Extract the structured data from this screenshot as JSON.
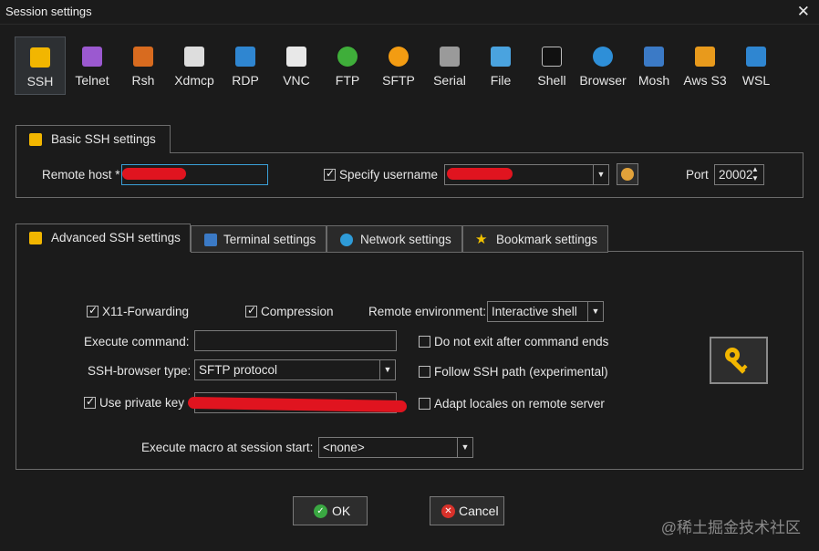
{
  "window": {
    "title": "Session settings"
  },
  "protocols": [
    {
      "label": "SSH",
      "icon": "key-icon",
      "color": "#f2b600",
      "active": true
    },
    {
      "label": "Telnet",
      "icon": "telnet-icon",
      "color": "#9b59d0"
    },
    {
      "label": "Rsh",
      "icon": "rsh-icon",
      "color": "#d86b1f"
    },
    {
      "label": "Xdmcp",
      "icon": "xdmcp-icon",
      "color": "#dddddd"
    },
    {
      "label": "RDP",
      "icon": "rdp-icon",
      "color": "#2f86d1"
    },
    {
      "label": "VNC",
      "icon": "vnc-icon",
      "color": "#e8e8e8"
    },
    {
      "label": "FTP",
      "icon": "ftp-icon",
      "color": "#3fae3a"
    },
    {
      "label": "SFTP",
      "icon": "sftp-icon",
      "color": "#f39c12"
    },
    {
      "label": "Serial",
      "icon": "serial-icon",
      "color": "#9a9a9a"
    },
    {
      "label": "File",
      "icon": "file-icon",
      "color": "#4aa3df"
    },
    {
      "label": "Shell",
      "icon": "shell-icon",
      "color": "#111111"
    },
    {
      "label": "Browser",
      "icon": "browser-icon",
      "color": "#2e8fd8"
    },
    {
      "label": "Mosh",
      "icon": "mosh-icon",
      "color": "#3b7ac6"
    },
    {
      "label": "Aws S3",
      "icon": "aws-s3-icon",
      "color": "#e89a1c"
    },
    {
      "label": "WSL",
      "icon": "wsl-icon",
      "color": "#2f86d1"
    }
  ],
  "basic": {
    "tab_label": "Basic SSH settings",
    "remote_host_label": "Remote host *",
    "remote_host_value": "",
    "specify_username_label": "Specify username",
    "specify_username_checked": true,
    "username_value": "",
    "port_label": "Port",
    "port_value": "20002"
  },
  "tabs": [
    {
      "label": "Advanced SSH settings",
      "active": true
    },
    {
      "label": "Terminal settings"
    },
    {
      "label": "Network settings"
    },
    {
      "label": "Bookmark settings"
    }
  ],
  "advanced": {
    "x11_label": "X11-Forwarding",
    "x11_checked": true,
    "compression_label": "Compression",
    "compression_checked": true,
    "remote_env_label": "Remote environment:",
    "remote_env_value": "Interactive shell",
    "execute_command_label": "Execute command:",
    "execute_command_value": "",
    "do_not_exit_label": "Do not exit after command ends",
    "do_not_exit_checked": false,
    "ssh_browser_label": "SSH-browser type:",
    "ssh_browser_value": "SFTP protocol",
    "follow_ssh_path_label": "Follow SSH path (experimental)",
    "follow_ssh_path_checked": false,
    "use_private_key_label": "Use private key",
    "use_private_key_checked": true,
    "private_key_value": "",
    "adapt_locales_label": "Adapt locales on remote server",
    "adapt_locales_checked": false,
    "macro_label": "Execute macro at session start:",
    "macro_value": "<none>"
  },
  "buttons": {
    "ok": "OK",
    "cancel": "Cancel"
  },
  "watermark": "@稀土掘金技术社区"
}
